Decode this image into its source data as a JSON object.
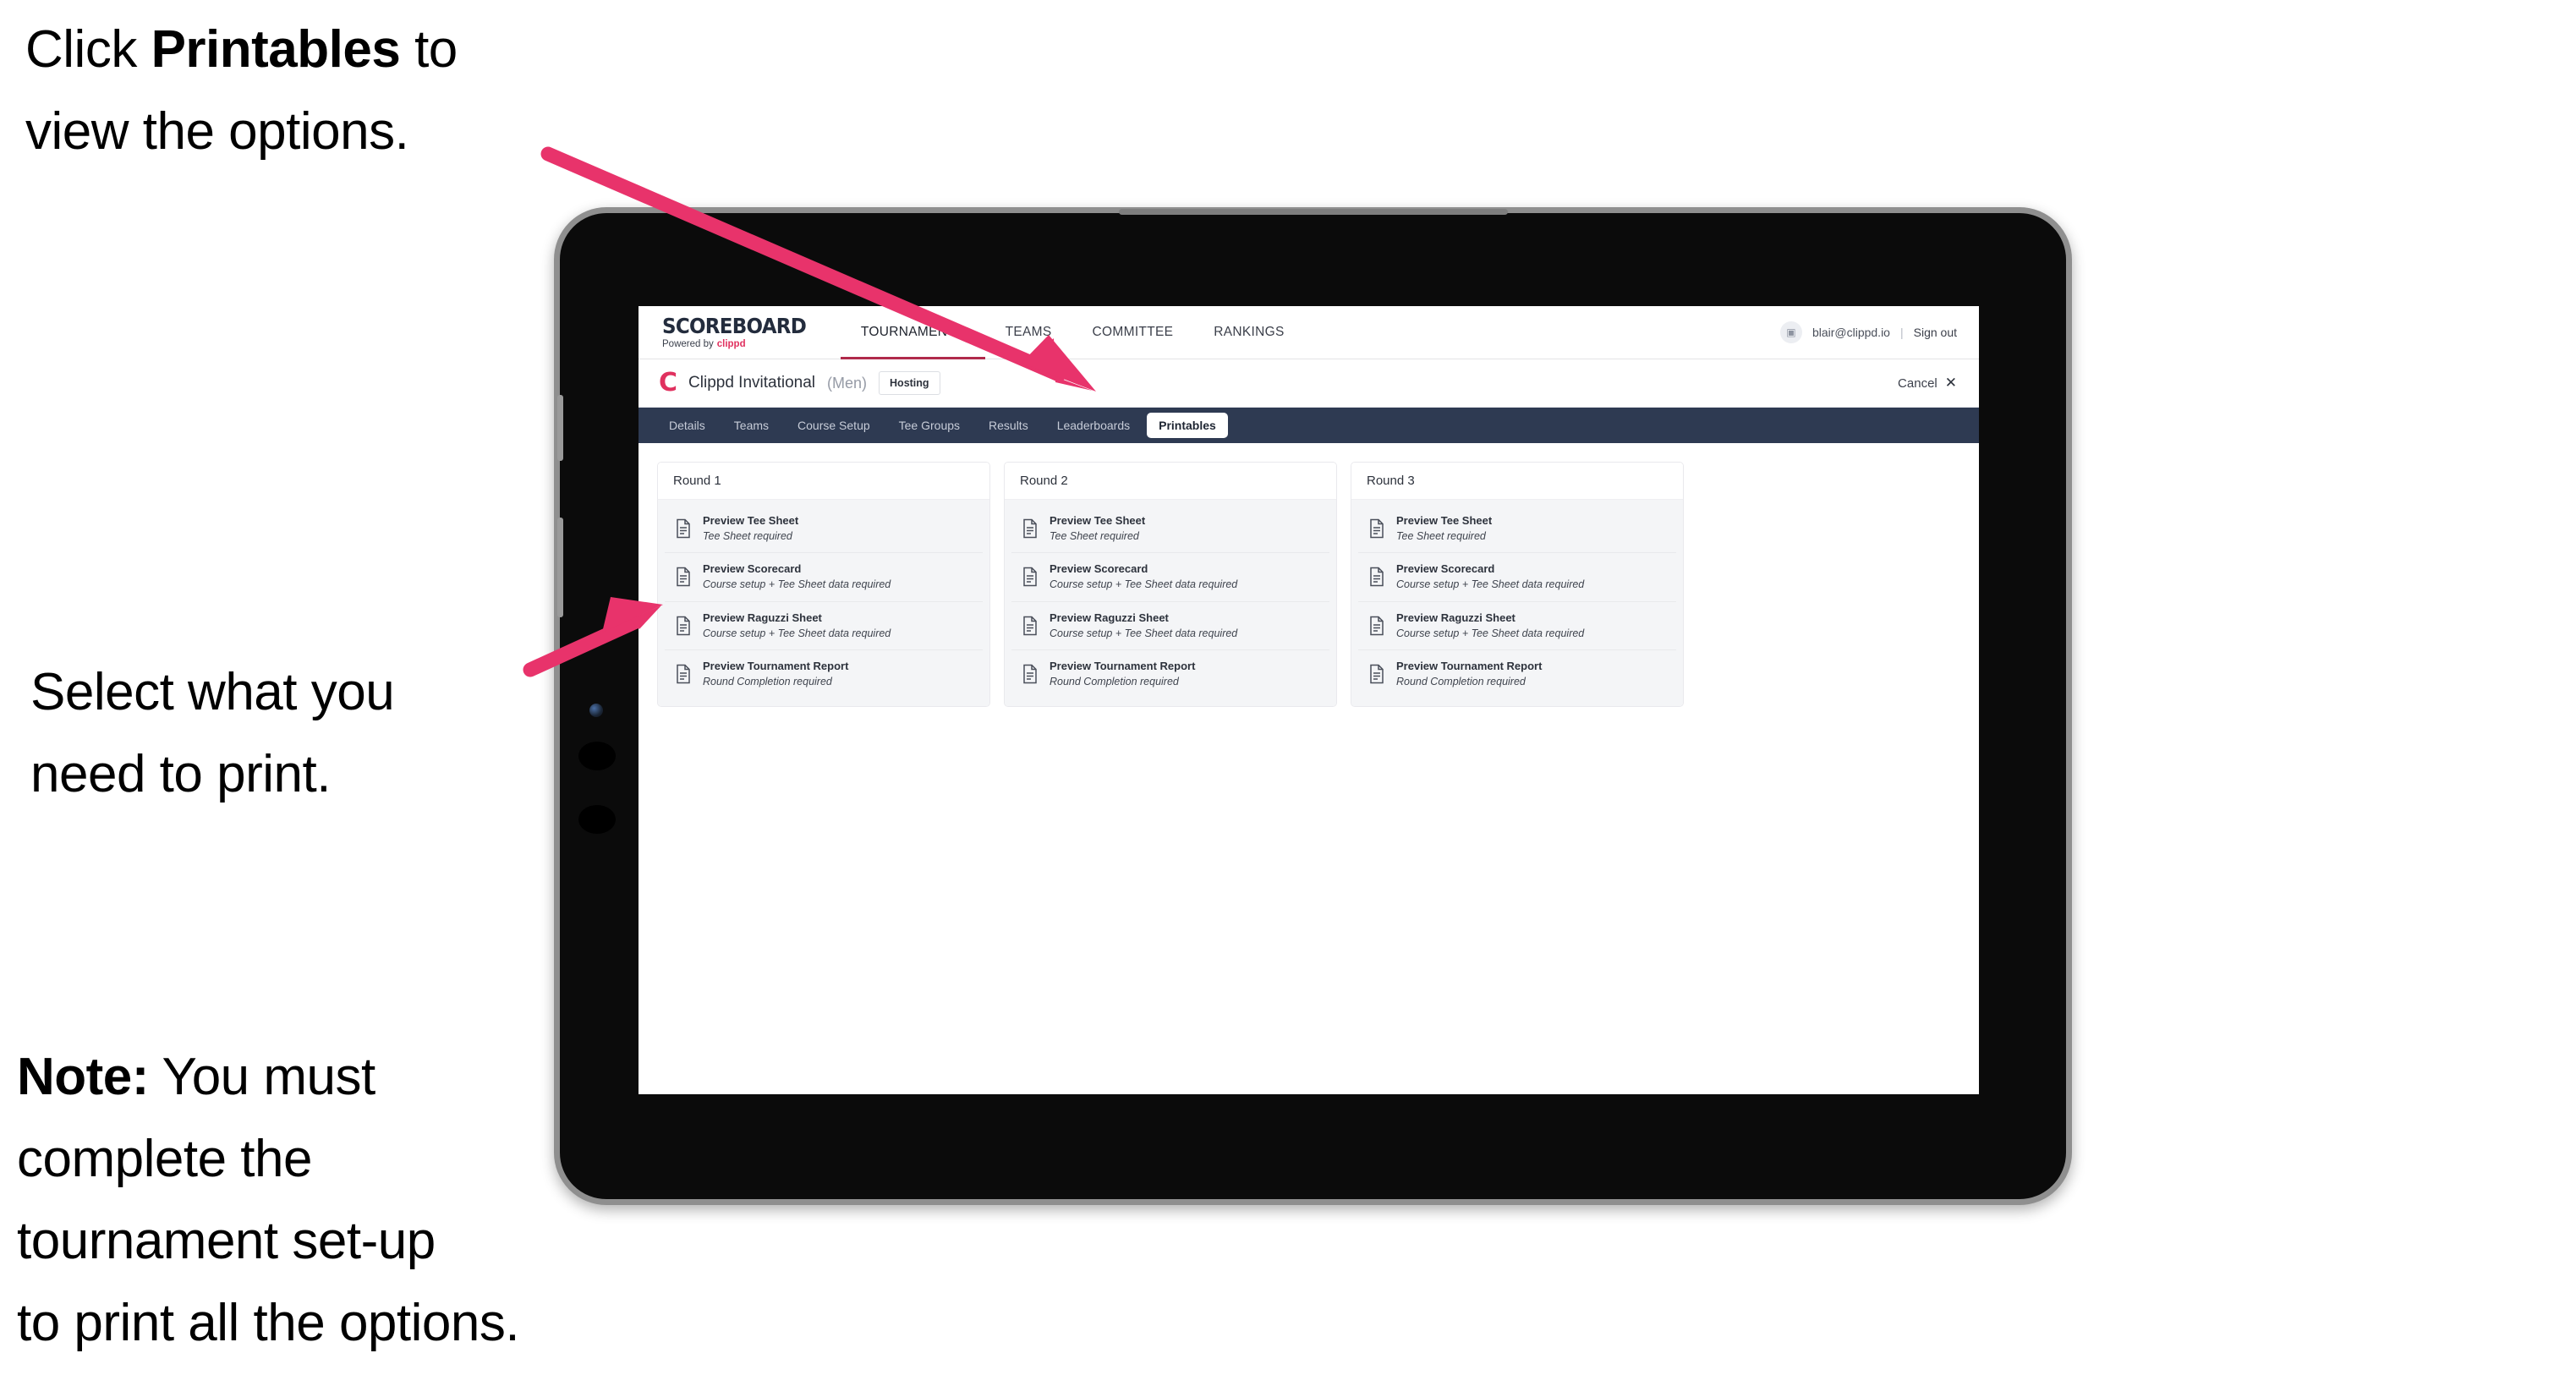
{
  "annotations": [
    {
      "id": "click",
      "prefix": "Click ",
      "bold": "Printables",
      "suffix": " to\nview the options."
    },
    {
      "id": "select",
      "prefix": "",
      "bold": "",
      "suffix": "Select what you\n need to print."
    },
    {
      "id": "note",
      "prefix": "",
      "bold": "Note:",
      "suffix": " You must\ncomplete the\ntournament set-up\nto print all the options."
    }
  ],
  "annotation_text": {
    "click_line1_pre": "Click ",
    "click_line1_bold": "Printables",
    "click_line1_post": " to",
    "click_line2": "view the options.",
    "select_line1": "Select what you",
    "select_line2": " need to print.",
    "note_bold": "Note:",
    "note_rest": " You must\ncomplete the\ntournament set-up\nto print all the options."
  },
  "colors": {
    "accent_pink": "#e8336b",
    "brand_red": "#e0315f",
    "tabbar_navy": "#2e3a52",
    "nav_underline": "#b02a4b",
    "card_body_gray": "#f4f5f7",
    "device_bezel": "#0b0b0b",
    "device_edge": "#8f8f8f"
  },
  "app": {
    "brand": {
      "title": "SCOREBOARD",
      "powered_by": "Powered by",
      "powered_brand": "clippd"
    },
    "top_nav": [
      {
        "label": "TOURNAMENTS",
        "active": true
      },
      {
        "label": "TEAMS",
        "active": false
      },
      {
        "label": "COMMITTEE",
        "active": false
      },
      {
        "label": "RANKINGS",
        "active": false
      }
    ],
    "account": {
      "avatar_glyph": "▣",
      "email": "blair@clippd.io",
      "divider": "|",
      "sign_out": "Sign out"
    },
    "tournament": {
      "logo_letter": "C",
      "name": "Clippd Invitational",
      "gender": "(Men)",
      "status_badge": "Hosting",
      "cancel_label": "Cancel",
      "cancel_icon": "✕"
    },
    "tabs": [
      {
        "label": "Details",
        "active": false
      },
      {
        "label": "Teams",
        "active": false
      },
      {
        "label": "Course Setup",
        "active": false
      },
      {
        "label": "Tee Groups",
        "active": false
      },
      {
        "label": "Results",
        "active": false
      },
      {
        "label": "Leaderboards",
        "active": false
      },
      {
        "label": "Printables",
        "active": true
      }
    ],
    "rounds": [
      {
        "title": "Round 1",
        "items": [
          {
            "title": "Preview Tee Sheet",
            "requirement": "Tee Sheet required"
          },
          {
            "title": "Preview Scorecard",
            "requirement": "Course setup + Tee Sheet data required"
          },
          {
            "title": "Preview Raguzzi Sheet",
            "requirement": "Course setup + Tee Sheet data required"
          },
          {
            "title": "Preview Tournament Report",
            "requirement": "Round Completion required"
          }
        ]
      },
      {
        "title": "Round 2",
        "items": [
          {
            "title": "Preview Tee Sheet",
            "requirement": "Tee Sheet required"
          },
          {
            "title": "Preview Scorecard",
            "requirement": "Course setup + Tee Sheet data required"
          },
          {
            "title": "Preview Raguzzi Sheet",
            "requirement": "Course setup + Tee Sheet data required"
          },
          {
            "title": "Preview Tournament Report",
            "requirement": "Round Completion required"
          }
        ]
      },
      {
        "title": "Round 3",
        "items": [
          {
            "title": "Preview Tee Sheet",
            "requirement": "Tee Sheet required"
          },
          {
            "title": "Preview Scorecard",
            "requirement": "Course setup + Tee Sheet data required"
          },
          {
            "title": "Preview Raguzzi Sheet",
            "requirement": "Course setup + Tee Sheet data required"
          },
          {
            "title": "Preview Tournament Report",
            "requirement": "Round Completion required"
          }
        ]
      }
    ]
  }
}
